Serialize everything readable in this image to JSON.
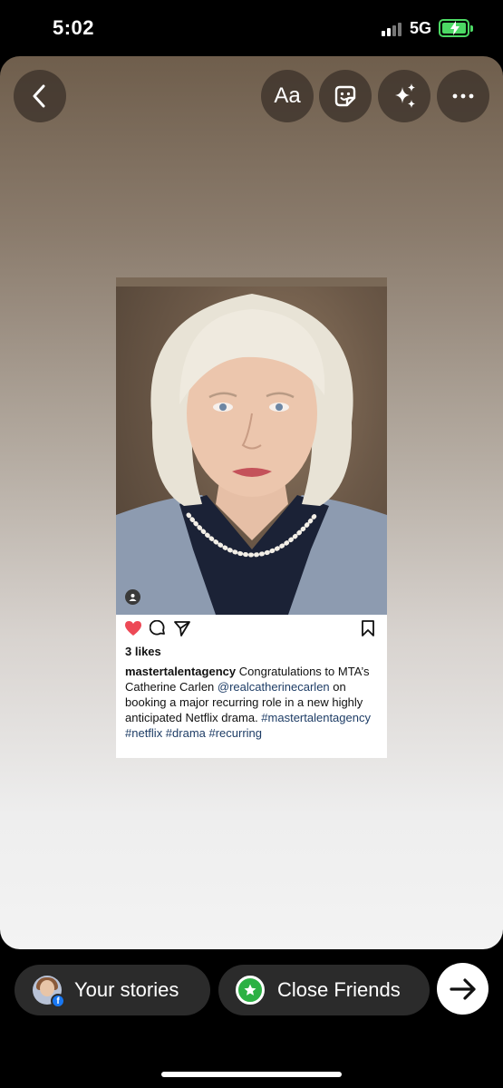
{
  "status": {
    "time": "5:02",
    "network": "5G"
  },
  "toolbar": {
    "text_label": "Aa"
  },
  "post": {
    "likes": "3 likes",
    "username": "mastertalentagency",
    "caption_part1": " Congratulations to MTA’s Catherine Carlen ",
    "mention": "@realcatherinecarlen",
    "caption_part2": " on booking a major recurring role in a new highly anticipated Netflix drama. ",
    "hashtags": "#mastertalentagency #netflix #drama #recurring",
    "heart_color": "#ed4956"
  },
  "bottom": {
    "your_stories": "Your stories",
    "close_friends": "Close Friends"
  },
  "icons": [
    "back-icon",
    "sticker-icon",
    "sparkles-icon",
    "more-icon",
    "heart-icon",
    "comment-icon",
    "share-icon",
    "bookmark-icon",
    "tag-user-icon",
    "facebook-icon",
    "star-icon",
    "arrow-right-icon"
  ]
}
